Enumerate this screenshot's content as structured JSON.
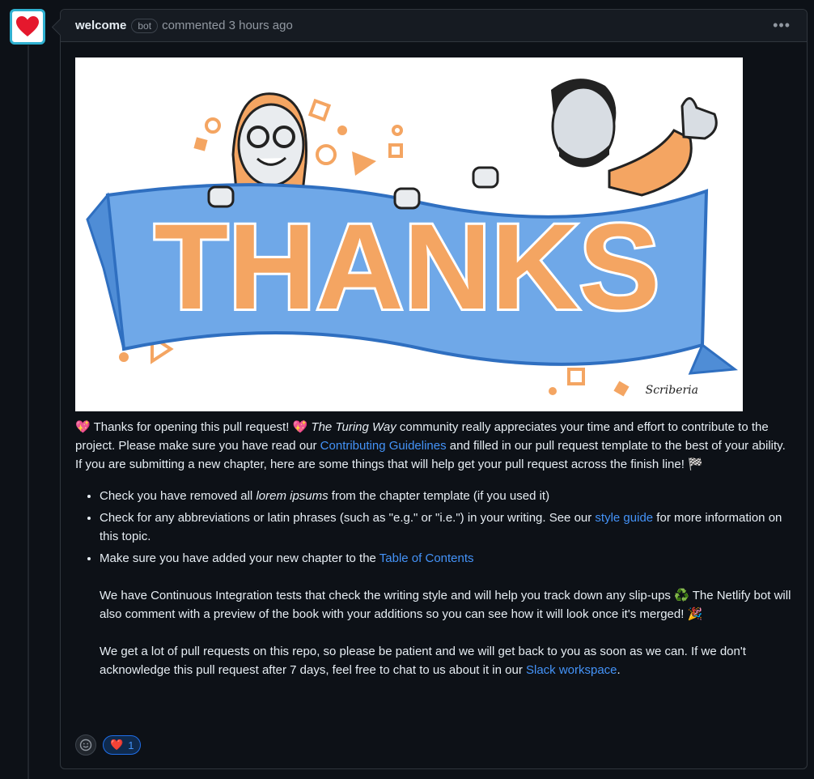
{
  "header": {
    "author": "welcome",
    "badge": "bot",
    "meta": "commented 3 hours ago",
    "menu_icon": "kebab-horizontal-icon"
  },
  "banner": {
    "word": "THANKS",
    "signature": "Scriberia"
  },
  "body": {
    "p1": {
      "emoji": "💖",
      "t1": " Thanks for opening this pull request! ",
      "emoji2": "💖",
      "em": "The Turing Way",
      "t2": " community really appreciates your time and effort to contribute to the project. Please make sure you have read our ",
      "link": "Contributing Guidelines",
      "t3": " and filled in our pull request template to the best of your ability."
    },
    "p2": {
      "text": "If you are submitting a new chapter, here are some things that will help get your pull request across the finish line! ",
      "emoji": "🏁"
    },
    "list": {
      "item1": {
        "pre": "Check you have removed all ",
        "em": "lorem ipsums",
        "post": " from the chapter template (if you used it)"
      },
      "item2": {
        "pre": "Check for any abbreviations or latin phrases (such as \"e.g.\" or \"i.e.\") in your writing. See our ",
        "link": "style guide",
        "post": " for more information on this topic."
      },
      "item3": {
        "pre": "Make sure you have added your new chapter to the ",
        "link": "Table of Contents",
        "para1": "We have Continuous Integration tests that check the writing style and will help you track down any slip-ups ",
        "para1_emoji": "♻️",
        "para1b": " The Netlify bot will also comment with a preview of the book with your additions so you can see how it will look once it's merged! ",
        "para1_emoji2": "🎉",
        "para2": "We get a lot of pull requests on this repo, so please be patient and we will get back to you as soon as we can. If we don't acknowledge this pull request after 7 days, feel free to chat to us about it in our ",
        "para2_link": "Slack workspace",
        "para2_end": "."
      }
    }
  },
  "reactions": {
    "add_icon": "smiley-icon",
    "heart_emoji": "❤️",
    "heart_count": "1"
  },
  "colors": {
    "background": "#0d1117",
    "link": "#4493f8",
    "banner_blue": "#6fa8e8",
    "banner_orange": "#f4a562"
  }
}
